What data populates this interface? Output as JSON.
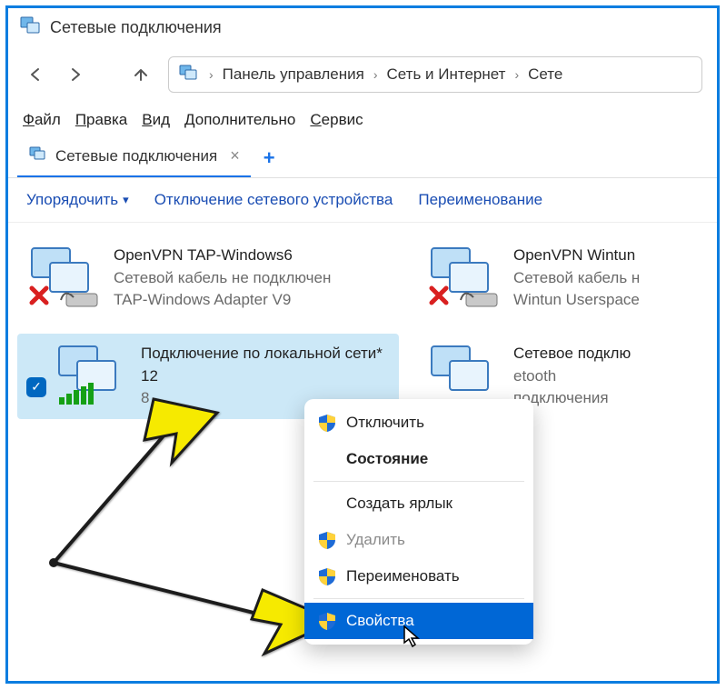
{
  "window": {
    "title": "Сетевые подключения"
  },
  "breadcrumb": {
    "items": [
      "Панель управления",
      "Сеть и Интернет",
      "Сете"
    ]
  },
  "menus": {
    "file": "Файл",
    "edit": "Правка",
    "view": "Вид",
    "extra": "Дополнительно",
    "service": "Сервис"
  },
  "tab": {
    "label": "Сетевые подключения"
  },
  "toolbar": {
    "organize": "Упорядочить",
    "disable": "Отключение сетевого устройства",
    "rename": "Переименование"
  },
  "connections": [
    {
      "name": "OpenVPN TAP-Windows6",
      "status": "Сетевой кабель не подключен",
      "adapter": "TAP-Windows Adapter V9",
      "disconnected": true
    },
    {
      "name": "OpenVPN Wintun",
      "status": "Сетевой кабель н",
      "adapter": "Wintun Userspace",
      "disconnected": true
    },
    {
      "name": "Подключение по локальной сети* 12",
      "status": "",
      "adapter": "8",
      "selected": true,
      "signal": true
    },
    {
      "name": "Сетевое подклю",
      "status": "etooth",
      "adapter": "подключения",
      "disconnected": false
    }
  ],
  "context_menu": {
    "items": [
      {
        "label": "Отключить",
        "shield": true
      },
      {
        "label": "Состояние",
        "bold": true
      },
      {
        "label": "Создать ярлык"
      },
      {
        "label": "Удалить",
        "shield": true,
        "disabled": true
      },
      {
        "label": "Переименовать",
        "shield": true
      },
      {
        "label": "Свойства",
        "shield": true,
        "highlight": true
      }
    ]
  }
}
